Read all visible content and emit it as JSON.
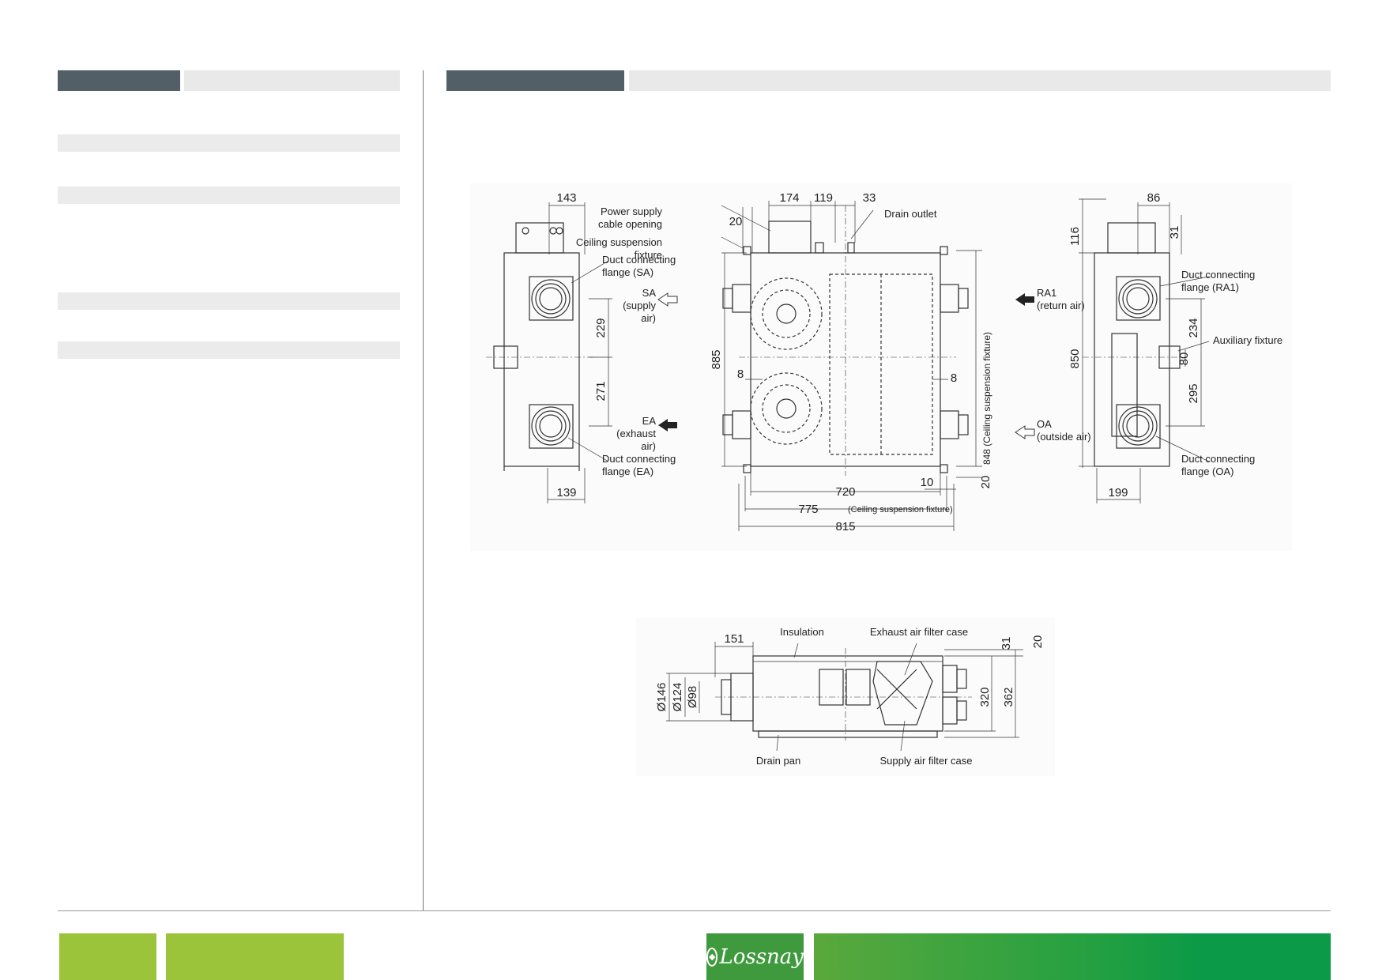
{
  "drawing_front": {
    "labels": {
      "power_supply_1": "Power supply",
      "power_supply_2": "cable opening",
      "ceiling_susp_1": "Ceiling suspension",
      "ceiling_susp_2": "fixture",
      "drain_outlet": "Drain outlet",
      "duct_sa_1": "Duct connecting",
      "duct_sa_2": "flange (SA)",
      "duct_ea_1": "Duct connecting",
      "duct_ea_2": "flange (EA)",
      "sa_1": "SA",
      "sa_2": "(supply",
      "sa_3": "air)",
      "ea_1": "EA",
      "ea_2": "(exhaust",
      "ea_3": "air)",
      "ra1_1": "RA1",
      "ra1_2": "(return air)",
      "oa_1": "OA",
      "oa_2": "(outside air)",
      "duct_ra1_1": "Duct connecting",
      "duct_ra1_2": "flange (RA1)",
      "duct_oa_1": "Duct connecting",
      "duct_oa_2": "flange (OA)",
      "aux_fixture": "Auxiliary fixture",
      "ceiling_vertical": "848 (Ceiling suspension fixture)",
      "ceiling_horizontal": "(Ceiling suspension fixture)"
    },
    "dims": {
      "d143": "143",
      "d139": "139",
      "d229": "229",
      "d271": "271",
      "d174": "174",
      "d119": "119",
      "d33": "33",
      "d20a": "20",
      "d885": "885",
      "d8a": "8",
      "d8b": "8",
      "d720": "720",
      "d775": "775",
      "d815": "815",
      "d10": "10",
      "d20b": "20",
      "d86": "86",
      "d116": "116",
      "d31": "31",
      "d850": "850",
      "d234": "234",
      "d80": "80",
      "d295": "295",
      "d199": "199"
    }
  },
  "drawing_side": {
    "labels": {
      "insulation": "Insulation",
      "exhaust_filter": "Exhaust air filter case",
      "drain_pan": "Drain pan",
      "supply_filter": "Supply air filter case"
    },
    "dims": {
      "d151": "151",
      "d31": "31",
      "d20": "20",
      "d146": "Ø146",
      "d124": "Ø124",
      "d98": "Ø98",
      "d320": "320",
      "d362": "362"
    }
  },
  "footer": {
    "logo_text": "Lossnay"
  }
}
